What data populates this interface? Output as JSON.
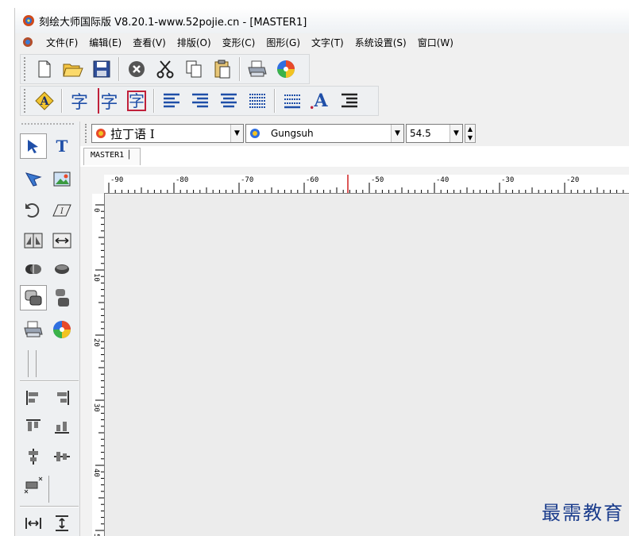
{
  "window": {
    "title": "刻绘大师国际版 V8.20.1-www.52pojie.cn - [MASTER1]"
  },
  "menu": [
    "文件(F)",
    "编辑(E)",
    "查看(V)",
    "排版(O)",
    "变形(C)",
    "图形(G)",
    "文字(T)",
    "系统设置(S)",
    "窗口(W)"
  ],
  "toolbar1": [
    "new-document-icon",
    "open-folder-icon",
    "save-disk-icon",
    "close-circle-icon",
    "cut-scissors-icon",
    "copy-icon",
    "paste-icon",
    "print-icon",
    "color-wheel-icon"
  ],
  "toolbar2": {
    "char_glyph": "字",
    "letter_a": "A"
  },
  "font_bar": {
    "font_name": "拉丁语 I",
    "font_face": "Gungsuh",
    "font_size": "54.5"
  },
  "document_tab": {
    "label": "MASTER1"
  },
  "ruler": {
    "horizontal": [
      "-90",
      "-80",
      "-70",
      "-60",
      "-50",
      "-40",
      "-30",
      "-20"
    ],
    "vertical": [
      "0",
      "10",
      "20",
      "30",
      "40",
      "50"
    ]
  },
  "watermark": "最需教育",
  "colors": {
    "ruler_marker": "#d02020",
    "accent_blue": "#1f4fa8",
    "accent_red": "#c0203a"
  }
}
